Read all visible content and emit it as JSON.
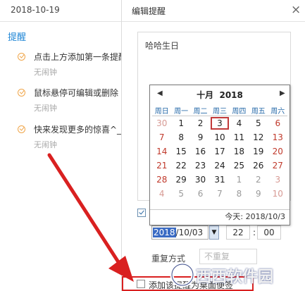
{
  "left_panel": {
    "date": "2018-10-19",
    "section": "提醒",
    "items": [
      {
        "title": "点击上方添加第一条提醒",
        "subtitle": "无闹钟"
      },
      {
        "title": "鼠标悬停可编辑或删除",
        "subtitle": "无闹钟"
      },
      {
        "title": "快来发现更多的惊喜^_",
        "subtitle": "无闹钟"
      }
    ]
  },
  "editor": {
    "title": "编辑提醒",
    "close_glyph": "×",
    "note_text": "哈哈生日",
    "date_year": "2018",
    "date_rest": "/10/03",
    "hour": "22",
    "minute": "00",
    "repeat_label": "重复方式",
    "repeat_value": "不重复",
    "desktop_note_label": "添加该提醒为桌面便签"
  },
  "calendar": {
    "month_label": "十月",
    "year": "2018",
    "weekdays": [
      "周日",
      "周一",
      "周二",
      "周三",
      "周四",
      "周五",
      "周六"
    ],
    "weeks": [
      [
        "30",
        "1",
        "2",
        "3",
        "4",
        "5",
        "6"
      ],
      [
        "7",
        "8",
        "9",
        "10",
        "11",
        "12",
        "13"
      ],
      [
        "14",
        "15",
        "16",
        "17",
        "18",
        "19",
        "20"
      ],
      [
        "21",
        "22",
        "23",
        "24",
        "25",
        "26",
        "27"
      ],
      [
        "28",
        "29",
        "30",
        "31",
        "1",
        "2",
        "3"
      ],
      [
        "4",
        "5",
        "6",
        "7",
        "8",
        "9",
        "10"
      ]
    ],
    "selected_day": "3",
    "today_label": "今天: 2018/10/3"
  },
  "watermark": {
    "text": "西西软件园"
  },
  "colors": {
    "accent": "#1f86d6",
    "alert": "#d92020",
    "check": "#f0a64a"
  }
}
